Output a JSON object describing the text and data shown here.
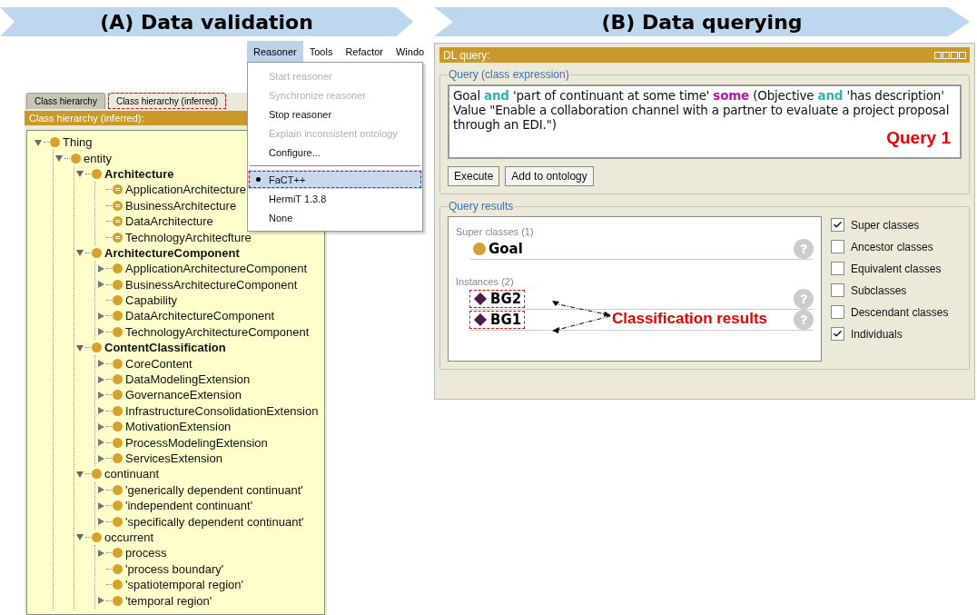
{
  "left_banner": {
    "title": "(A) Data validation"
  },
  "menu_bar": {
    "items": [
      {
        "label": "Reasoner",
        "selected": true
      },
      {
        "label": "Tools",
        "selected": false
      },
      {
        "label": "Refactor",
        "selected": false
      },
      {
        "label": "Windo",
        "selected": false
      }
    ]
  },
  "reasoner_menu": {
    "actions": [
      {
        "label": "Start reasoner",
        "disabled": true
      },
      {
        "label": "Synchronize reasoner",
        "disabled": true
      },
      {
        "label": "Stop reasoner",
        "disabled": false
      },
      {
        "label": "Explain inconsistent ontology",
        "disabled": true
      },
      {
        "label": "Configure...",
        "disabled": false
      }
    ],
    "reasoners": [
      {
        "label": "FaCT++",
        "selected": true,
        "highlighted": true
      },
      {
        "label": "HermiT 1.3.8",
        "selected": false,
        "highlighted": false
      },
      {
        "label": "None",
        "selected": false,
        "highlighted": false
      }
    ]
  },
  "class_hierarchy": {
    "tabs": [
      {
        "label": "Class hierarchy",
        "selected": false,
        "highlighted": false
      },
      {
        "label": "Class hierarchy (inferred)",
        "selected": true,
        "highlighted": true
      }
    ],
    "header": "Class hierarchy (inferred):",
    "tree": [
      {
        "label": "Thing",
        "expanded": true,
        "kind": "class",
        "bold": false,
        "children": [
          {
            "label": "entity",
            "expanded": true,
            "kind": "class",
            "bold": false,
            "children": [
              {
                "label": "Architecture",
                "expanded": true,
                "kind": "class",
                "bold": true,
                "children": [
                  {
                    "label": "ApplicationArchitecture",
                    "kind": "defined",
                    "bold": false
                  },
                  {
                    "label": "BusinessArchitecture",
                    "kind": "defined",
                    "bold": false
                  },
                  {
                    "label": "DataArchitecture",
                    "kind": "defined",
                    "bold": false
                  },
                  {
                    "label": "TechnologyArchitecfture",
                    "kind": "defined",
                    "bold": false
                  }
                ]
              },
              {
                "label": "ArchitectureComponent",
                "expanded": true,
                "kind": "class",
                "bold": true,
                "children": [
                  {
                    "label": "ApplicationArchitectureComponent",
                    "expanded": false,
                    "kind": "class",
                    "bold": false
                  },
                  {
                    "label": "BusinessArchitectureComponent",
                    "expanded": false,
                    "kind": "class",
                    "bold": false
                  },
                  {
                    "label": "Capability",
                    "kind": "class",
                    "bold": false
                  },
                  {
                    "label": "DataArchitectureComponent",
                    "expanded": false,
                    "kind": "class",
                    "bold": false
                  },
                  {
                    "label": "TechnologyArchitectureComponent",
                    "expanded": false,
                    "kind": "class",
                    "bold": false
                  }
                ]
              },
              {
                "label": "ContentClassification",
                "expanded": true,
                "kind": "class",
                "bold": true,
                "children": [
                  {
                    "label": "CoreContent",
                    "expanded": false,
                    "kind": "class",
                    "bold": false
                  },
                  {
                    "label": "DataModelingExtension",
                    "expanded": false,
                    "kind": "class",
                    "bold": false
                  },
                  {
                    "label": "GovernanceExtension",
                    "expanded": false,
                    "kind": "class",
                    "bold": false
                  },
                  {
                    "label": "InfrastructureConsolidationExtension",
                    "expanded": false,
                    "kind": "class",
                    "bold": false
                  },
                  {
                    "label": "MotivationExtension",
                    "expanded": false,
                    "kind": "class",
                    "bold": false
                  },
                  {
                    "label": "ProcessModelingExtension",
                    "expanded": false,
                    "kind": "class",
                    "bold": false
                  },
                  {
                    "label": "ServicesExtension",
                    "expanded": false,
                    "kind": "class",
                    "bold": false
                  }
                ]
              },
              {
                "label": "continuant",
                "expanded": true,
                "kind": "class",
                "bold": false,
                "children": [
                  {
                    "label": "'generically dependent continuant'",
                    "expanded": false,
                    "kind": "class",
                    "bold": false
                  },
                  {
                    "label": "'independent continuant'",
                    "expanded": false,
                    "kind": "class",
                    "bold": false
                  },
                  {
                    "label": "'specifically dependent continuant'",
                    "expanded": false,
                    "kind": "class",
                    "bold": false
                  }
                ]
              },
              {
                "label": "occurrent",
                "expanded": true,
                "kind": "class",
                "bold": false,
                "children": [
                  {
                    "label": "process",
                    "expanded": false,
                    "kind": "class",
                    "bold": false
                  },
                  {
                    "label": "'process boundary'",
                    "kind": "class",
                    "bold": false
                  },
                  {
                    "label": "'spatiotemporal region'",
                    "kind": "class",
                    "bold": false
                  },
                  {
                    "label": "'temporal region'",
                    "expanded": false,
                    "kind": "class",
                    "bold": false
                  }
                ]
              }
            ]
          }
        ]
      }
    ]
  },
  "right_banner": {
    "title": "(B) Data querying"
  },
  "dl_query": {
    "title": "DL query:",
    "query_group": {
      "legend": "Query (class expression)",
      "segments": [
        {
          "text": "Goal ",
          "kind": "plain"
        },
        {
          "text": "and",
          "kind": "connective"
        },
        {
          "text": " 'part of continuant at some time' ",
          "kind": "plain"
        },
        {
          "text": "some",
          "kind": "restriction"
        },
        {
          "text": " (Objective ",
          "kind": "plain"
        },
        {
          "text": "and",
          "kind": "connective"
        },
        {
          "text": " 'has description' Value \"Enable a collaboration channel with a partner to evaluate a project proposal through an EDI.\")",
          "kind": "plain"
        }
      ],
      "annotation": "Query 1",
      "buttons": [
        "Execute",
        "Add to ontology"
      ]
    },
    "results_group": {
      "legend": "Query results",
      "sections": [
        {
          "heading": "Super classes (1)",
          "entries": [
            {
              "label": "Goal",
              "kind": "class",
              "highlighted": false
            }
          ]
        },
        {
          "heading": "Instances (2)",
          "entries": [
            {
              "label": "BG2",
              "kind": "individual",
              "highlighted": true
            },
            {
              "label": "BG1",
              "kind": "individual",
              "highlighted": true
            }
          ]
        }
      ],
      "annotation": "Classification results",
      "options": [
        {
          "label": "Super classes",
          "checked": true
        },
        {
          "label": "Ancestor classes",
          "checked": false
        },
        {
          "label": "Equivalent classes",
          "checked": false
        },
        {
          "label": "Subclasses",
          "checked": false
        },
        {
          "label": "Descendant classes",
          "checked": false
        },
        {
          "label": "Individuals",
          "checked": true
        }
      ]
    }
  }
}
